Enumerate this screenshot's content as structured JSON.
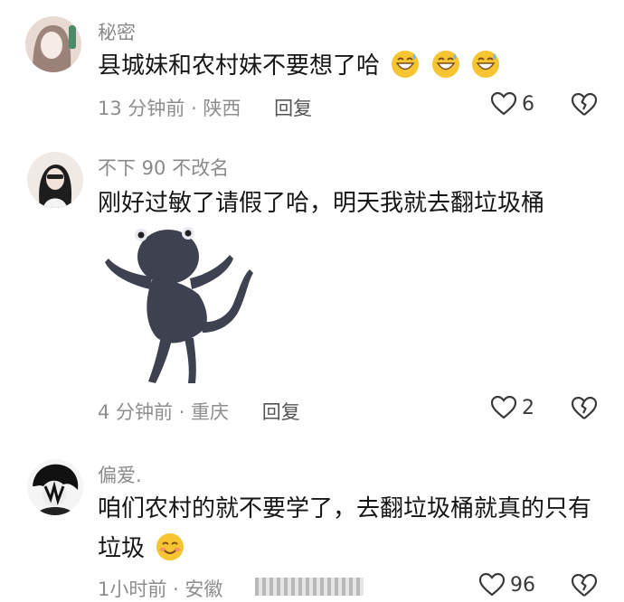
{
  "comments": [
    {
      "username": "秘密",
      "text": "县城妹和农村妹不要想了哈",
      "emoji": "grinning-sweat-emoji x3",
      "time": "13 分钟前 · 陕西",
      "reply_label": "回复",
      "likes": "6"
    },
    {
      "username": "不下 90 不改名",
      "text": "刚好过敏了请假了哈，明天我就去翻垃圾桶",
      "sticker": "dancing-black-creature-sticker",
      "time": "4 分钟前 · 重庆",
      "reply_label": "回复",
      "likes": "2"
    },
    {
      "username": "偏爱.",
      "text_line1": "咱们农村的就不要学了，去翻垃圾桶就真的只有",
      "text_line2": "垃圾",
      "emoji": "smiling-blush-emoji",
      "time": "1小时前 · 安徽",
      "likes": "96"
    }
  ],
  "colors": {
    "meta": "#8e8e8e",
    "text": "#161616",
    "emoji_yellow": "#f7c531"
  }
}
